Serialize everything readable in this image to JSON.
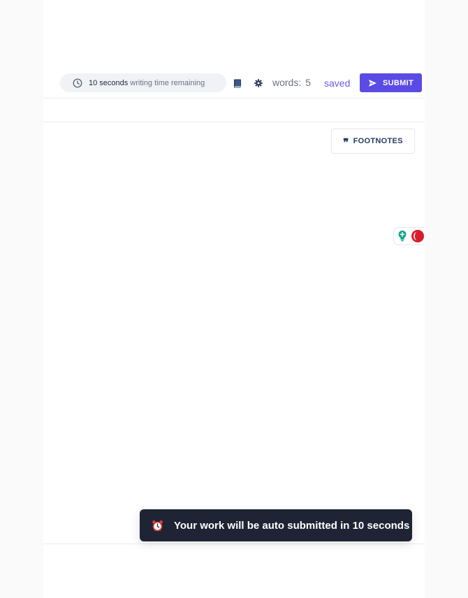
{
  "toolbar": {
    "timer_seconds": "10 seconds",
    "timer_suffix": "writing time remaining",
    "book_icon": "book-icon",
    "gear_icon": "gear-icon",
    "words_label": "words:",
    "words_count": "5",
    "save_status": "saved",
    "submit_label": "SUBMIT"
  },
  "editor": {
    "footnotes_label": "FOOTNOTES"
  },
  "widget": {
    "bulb_icon": "lightbulb-plus-icon",
    "grammar_icon": "grammar-checker-icon"
  },
  "toast": {
    "icon": "alarm-clock-icon",
    "message": "Your work will be auto submitted in 10 seconds"
  },
  "colors": {
    "accent": "#5b4be5",
    "saved_text": "#6d5be3",
    "toast_bg": "#1e2433",
    "footnotes_text": "#243b63",
    "bulb": "#14a38b",
    "grammar_red": "#d81b2a"
  }
}
